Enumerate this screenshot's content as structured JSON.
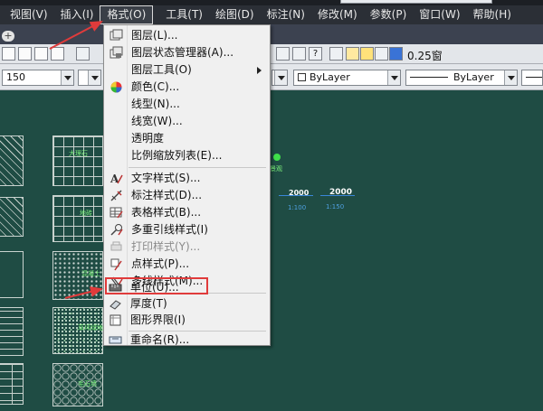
{
  "menubar": {
    "items": [
      {
        "label": "视图(V)"
      },
      {
        "label": "插入(I)"
      },
      {
        "label": "格式(O)"
      },
      {
        "label": "工具(T)"
      },
      {
        "label": "绘图(D)"
      },
      {
        "label": "标注(N)"
      },
      {
        "label": "修改(M)"
      },
      {
        "label": "参数(P)"
      },
      {
        "label": "窗口(W)"
      },
      {
        "label": "帮助(H)"
      }
    ]
  },
  "tabs": {
    "add_label": "+"
  },
  "toolbar": {
    "scale_combo": "150",
    "layer_label": "0.25窗",
    "color_combo": "ByLayer",
    "linetype_combo": "ByLayer",
    "help_label": "?"
  },
  "format_menu": {
    "items": [
      {
        "label": "图层(L)...",
        "icon": "layers-icon",
        "enabled": true
      },
      {
        "label": "图层状态管理器(A)...",
        "icon": "layer-states-icon",
        "enabled": true
      },
      {
        "label": "图层工具(O)",
        "icon": "",
        "enabled": true,
        "submenu": true
      },
      {
        "label": "颜色(C)...",
        "icon": "color-wheel-icon",
        "enabled": true
      },
      {
        "label": "线型(N)...",
        "icon": "",
        "enabled": true
      },
      {
        "label": "线宽(W)...",
        "icon": "",
        "enabled": true
      },
      {
        "label": "透明度",
        "icon": "",
        "enabled": true
      },
      {
        "label": "比例缩放列表(E)...",
        "icon": "",
        "enabled": true
      },
      {
        "label": "文字样式(S)...",
        "icon": "text-style-icon",
        "enabled": true
      },
      {
        "label": "标注样式(D)...",
        "icon": "dimension-style-icon",
        "enabled": true
      },
      {
        "label": "表格样式(B)...",
        "icon": "table-style-icon",
        "enabled": true
      },
      {
        "label": "多重引线样式(I)",
        "icon": "multileader-style-icon",
        "enabled": true
      },
      {
        "label": "打印样式(Y)...",
        "icon": "plot-style-icon",
        "enabled": false
      },
      {
        "label": "点样式(P)...",
        "icon": "point-style-icon",
        "enabled": true
      },
      {
        "label": "多线样式(M)...",
        "icon": "multiline-style-icon",
        "enabled": true
      },
      {
        "label": "单位(U)...",
        "icon": "units-icon",
        "enabled": true
      },
      {
        "label": "厚度(T)",
        "icon": "thickness-icon",
        "enabled": true
      },
      {
        "label": "图形界限(I)",
        "icon": "drawing-limits-icon",
        "enabled": true
      },
      {
        "label": "重命名(R)...",
        "icon": "rename-icon",
        "enabled": true
      }
    ]
  },
  "drawing": {
    "dim1": "2000",
    "dim2": "2000",
    "scale1": "1:100",
    "scale2": "1:150",
    "pattern_labels": [
      "大理石",
      "地砖",
      "混凝土",
      "草坪绿地",
      "毛石墙"
    ],
    "marker_label": "景观"
  },
  "colors": {
    "menubar_bg": "#2b2f36",
    "drawing_bg": "#1f4c44",
    "highlight_red": "#e03b3b",
    "label_green": "#7cf07c"
  }
}
